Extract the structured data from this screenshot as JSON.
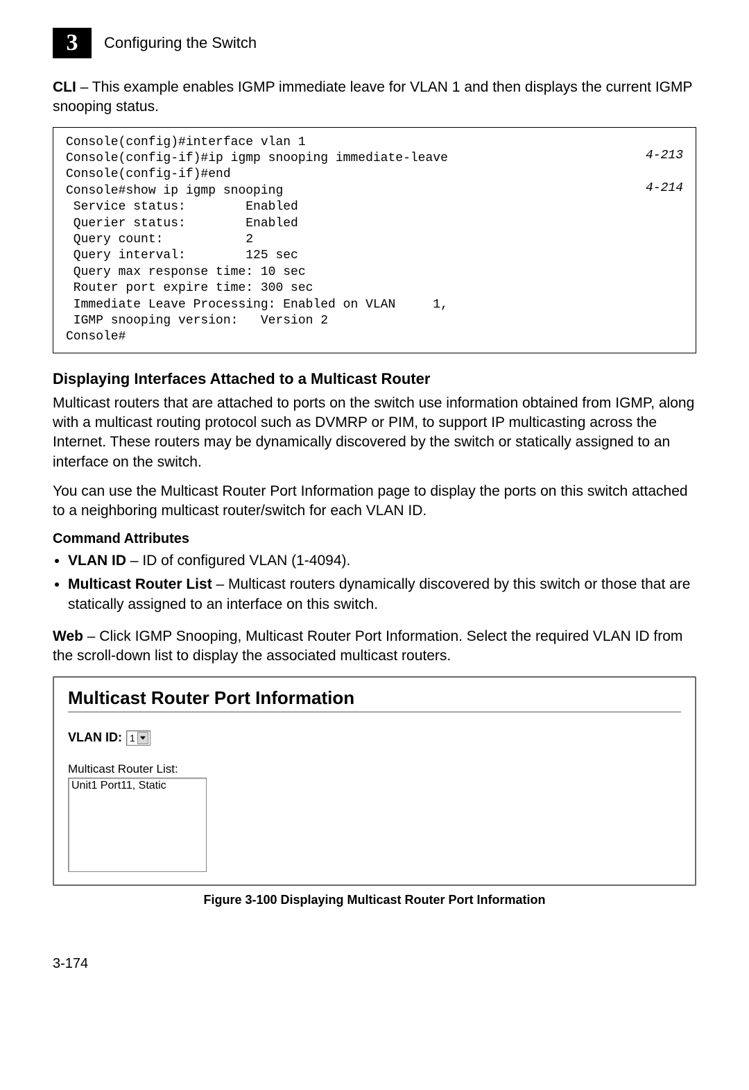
{
  "header": {
    "chapter_number": "3",
    "chapter_title": "Configuring the Switch"
  },
  "intro_para": {
    "prefix": "CLI",
    "text": " – This example enables IGMP immediate leave for VLAN 1 and then displays the current IGMP snooping status."
  },
  "cli": {
    "line1": "Console(config)#interface vlan 1",
    "line2": "Console(config-if)#ip igmp snooping immediate-leave",
    "ref2": "4-213",
    "line3": "Console(config-if)#end",
    "line4": "Console#show ip igmp snooping",
    "ref4": "4-214",
    "line5": " Service status:        Enabled",
    "line6": " Querier status:        Enabled",
    "line7": " Query count:           2",
    "line8": " Query interval:        125 sec",
    "line9": " Query max response time: 10 sec",
    "line10": " Router port expire time: 300 sec",
    "line11": " Immediate Leave Processing: Enabled on VLAN     1,",
    "line12": " IGMP snooping version:   Version 2",
    "line13": "Console#"
  },
  "section": {
    "heading": "Displaying Interfaces Attached to a Multicast Router",
    "para1": "Multicast routers that are attached to ports on the switch use information obtained from IGMP, along with a multicast routing protocol such as DVMRP or PIM, to support IP multicasting across the Internet. These routers may be dynamically discovered by the switch or statically assigned to an interface on the switch.",
    "para2": "You can use the Multicast Router Port Information page to display the ports on this switch attached to a neighboring multicast router/switch for each VLAN ID.",
    "cmd_attr_heading": "Command Attributes",
    "bullet1_bold": "VLAN ID",
    "bullet1_rest": " – ID of configured VLAN (1-4094).",
    "bullet2_bold": "Multicast Router List",
    "bullet2_rest": " – Multicast routers dynamically discovered by this switch or those that are statically assigned to an interface on this switch.",
    "web_prefix": "Web",
    "web_text": " – Click IGMP Snooping, Multicast Router Port Information. Select the required VLAN ID from the scroll-down list to display the associated multicast routers."
  },
  "web_figure": {
    "title": "Multicast Router Port Information",
    "vlan_label": "VLAN ID:",
    "vlan_value": "1",
    "mr_label": "Multicast Router List:",
    "mr_item": "Unit1 Port11, Static"
  },
  "figure_caption": "Figure 3-100  Displaying Multicast Router Port Information",
  "page_number": "3-174"
}
